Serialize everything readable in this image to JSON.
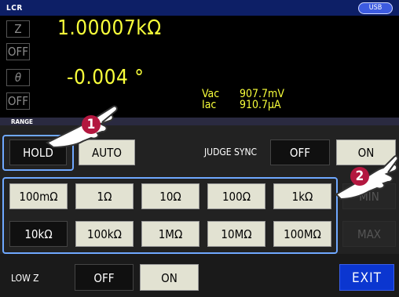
{
  "header": {
    "title": "LCR",
    "usb_label": "USB"
  },
  "measurement": {
    "primary": {
      "param": "Z",
      "value": "1.00007kΩ"
    },
    "secondary": {
      "param": "θ",
      "value": "-0.004 °"
    },
    "off_label_1": "OFF",
    "off_label_2": "OFF",
    "monitor": {
      "vac_label": "Vac",
      "vac_value": "907.7mV",
      "iac_label": "Iac",
      "iac_value": "910.7μA"
    }
  },
  "range": {
    "section_label": "RANGE",
    "hold_label": "HOLD",
    "auto_label": "AUTO",
    "judge_sync_label": "JUDGE SYNC",
    "judge_off": "OFF",
    "judge_on": "ON",
    "row1": [
      "100mΩ",
      "1Ω",
      "10Ω",
      "100Ω",
      "1kΩ"
    ],
    "row2": [
      "10kΩ",
      "100kΩ",
      "1MΩ",
      "10MΩ",
      "100MΩ"
    ],
    "selected": "10kΩ",
    "min_label": "MIN",
    "max_label": "MAX"
  },
  "low_z": {
    "label": "LOW Z",
    "off_label": "OFF",
    "on_label": "ON"
  },
  "exit_label": "EXIT",
  "callouts": [
    "1",
    "2"
  ],
  "colors": {
    "value_yellow": "#f8ff3a",
    "title_bar": "#0d1f66",
    "exit_blue": "#0b36d0",
    "highlight_frame": "#6fa8ff",
    "callout_red": "#b3173f"
  }
}
